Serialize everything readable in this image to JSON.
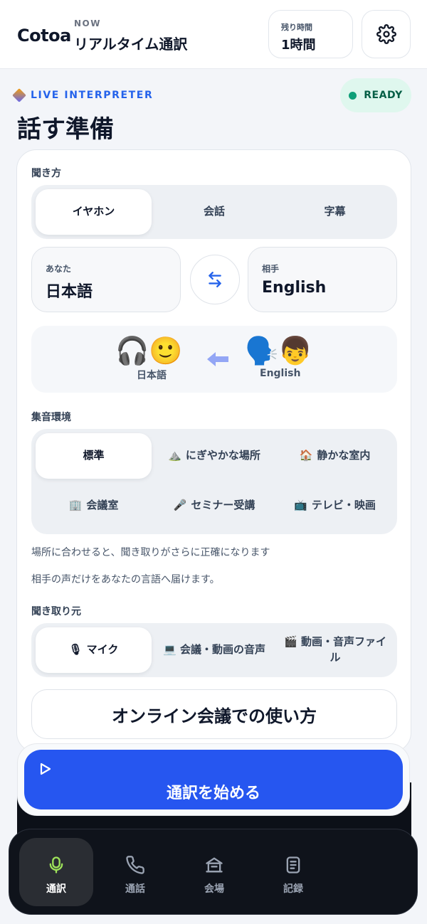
{
  "header": {
    "brand": "Cotoa",
    "now_label": "NOW",
    "title": "リアルタイム通訳",
    "remaining_label": "残り時間",
    "remaining_value": "1時間",
    "settings_icon": "gear-icon"
  },
  "hero": {
    "live_label": "LIVE INTERPRETER",
    "page_title": "話す準備",
    "status": "READY",
    "status_color": "#0f9f78"
  },
  "listen": {
    "label": "聞き方",
    "options": [
      "イヤホン",
      "会話",
      "字幕"
    ],
    "selected": "イヤホン"
  },
  "languages": {
    "you_label": "あなた",
    "you_value": "日本語",
    "other_label": "相手",
    "other_value": "English",
    "swap_icon": "swap-arrows-icon"
  },
  "illustration": {
    "left_emoji": "🎧🙂",
    "left_label": "日本語",
    "right_emoji": "🗣️👦",
    "right_label": "English",
    "arrow_icon": "arrow-left-icon"
  },
  "environment": {
    "label": "集音環境",
    "options": [
      {
        "icon": "",
        "label": "標準"
      },
      {
        "icon": "⛰️",
        "label": "にぎやかな場所"
      },
      {
        "icon": "🏠",
        "label": "静かな室内"
      },
      {
        "icon": "🏢",
        "label": "会議室"
      },
      {
        "icon": "🎤",
        "label": "セミナー受講"
      },
      {
        "icon": "📺",
        "label": "テレビ・映画"
      }
    ],
    "selected": "標準"
  },
  "helpers": {
    "line1": "場所に合わせると、聞き取りがさらに正確になります",
    "line2": "相手の声だけをあなたの言語へ届けます。"
  },
  "source": {
    "label": "聞き取り元",
    "options": [
      {
        "icon": "🎙",
        "label": "マイク"
      },
      {
        "icon": "💻",
        "label": "会議・動画の音声"
      },
      {
        "icon": "🎬",
        "label": "動画・音声ファイル"
      }
    ],
    "selected": "マイク"
  },
  "howto_button": "オンライン会議での使い方",
  "start_button": "通訳を始める",
  "accent_color": "#2656f0",
  "nav": {
    "items": [
      {
        "label": "通訳",
        "icon": "mic-icon"
      },
      {
        "label": "通話",
        "icon": "phone-icon"
      },
      {
        "label": "会場",
        "icon": "venue-icon"
      },
      {
        "label": "記録",
        "icon": "document-icon"
      }
    ],
    "active": "通訳"
  }
}
